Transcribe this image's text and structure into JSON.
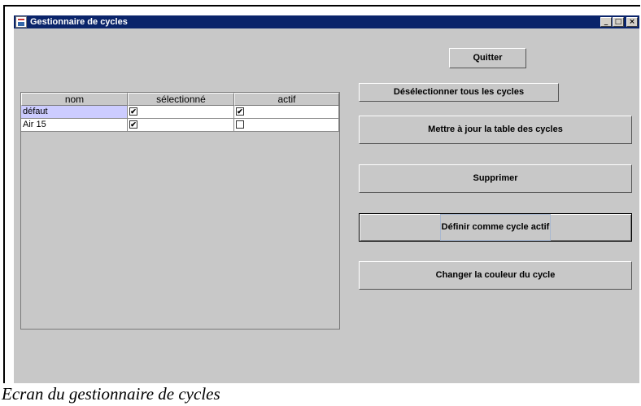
{
  "window": {
    "title": "Gestionnaire de cycles",
    "controls": {
      "minimize": "_",
      "maximize": "□",
      "close": "×"
    }
  },
  "table": {
    "columns": [
      "nom",
      "sélectionné",
      "actif"
    ],
    "rows": [
      {
        "nom": "défaut",
        "selectionne": true,
        "actif": true,
        "highlighted": true
      },
      {
        "nom": "Air 15",
        "selectionne": true,
        "actif": false,
        "highlighted": false
      }
    ]
  },
  "buttons": {
    "quit": "Quitter",
    "deselect_all": "Désélectionner tous les cycles",
    "update_table": "Mettre à jour la table des cycles",
    "delete": "Supprimer",
    "set_active": "Définir comme cycle actif",
    "change_color": "Changer la couleur du cycle"
  },
  "caption": "Ecran du gestionnaire de cycles",
  "colors": {
    "titlebar": "#0a246a",
    "window_bg": "#c8c8c8",
    "row_selection": "#ccccff"
  }
}
